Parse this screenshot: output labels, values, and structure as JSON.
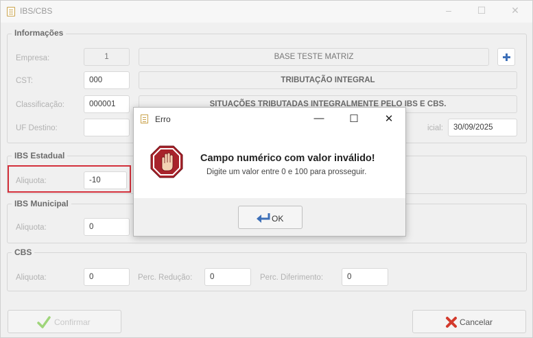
{
  "window": {
    "title": "IBS/CBS",
    "minimize": "–",
    "maximize": "☐",
    "close": "✕"
  },
  "informacoes": {
    "legend": "Informações",
    "empresa_label": "Empresa:",
    "empresa_code": "1",
    "empresa_name": "BASE TESTE MATRIZ",
    "cst_label": "CST:",
    "cst_value": "000",
    "cst_desc": "TRIBUTAÇÃO INTEGRAL",
    "classificacao_label": "Classificação:",
    "classificacao_value": "000001",
    "classificacao_desc": "SITUAÇÕES TRIBUTADAS INTEGRALMENTE PELO IBS E CBS.",
    "uf_label": "UF Destino:",
    "uf_value": "",
    "data_label_partial": "icial:",
    "data_value": "30/09/2025"
  },
  "ibs_estadual": {
    "legend": "IBS Estadual",
    "aliquota_label": "Aliquota:",
    "aliquota_value": "-10"
  },
  "ibs_municipal": {
    "legend": "IBS Municipal",
    "aliquota_label": "Aliquota:",
    "aliquota_value": "0"
  },
  "cbs": {
    "legend": "CBS",
    "aliquota_label": "Aliquota:",
    "aliquota_value": "0",
    "reducao_label": "Perc. Redução:",
    "reducao_value": "0",
    "diferimento_label": "Perc. Diferimento:",
    "diferimento_value": "0"
  },
  "footer": {
    "confirm_label": "Confirmar",
    "cancel_label": "Cancelar"
  },
  "dialog": {
    "title": "Erro",
    "minimize": "—",
    "maximize": "☐",
    "close": "✕",
    "message_title": "Campo numérico com valor inválido!",
    "message_body": "Digite um valor entre 0 e 100 para prosseguir.",
    "ok_label": "OK"
  },
  "colors": {
    "error_frame": "#d32f3a",
    "plus_icon": "#3d6fb8",
    "stop_icon": "#a8232b",
    "confirm_icon": "#7cc04b",
    "cancel_icon": "#d33a2c"
  }
}
